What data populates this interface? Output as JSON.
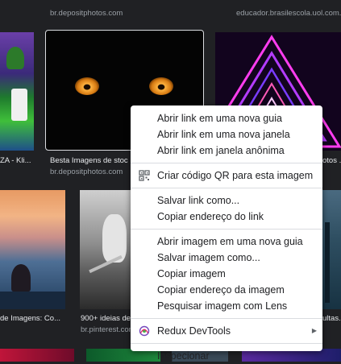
{
  "results": {
    "top_sources": [
      "br.depositphotos.com",
      "educador.brasilescola.uol.com.br"
    ],
    "row1": [
      {
        "caption": "ZA - Kli...",
        "source": ""
      },
      {
        "caption": "Besta Imagens de stoc",
        "source": "br.depositphotos.com"
      },
      {
        "caption": "otos ...",
        "source": ""
      }
    ],
    "row2": [
      {
        "caption": "de Imagens: Co...",
        "source": ""
      },
      {
        "caption": "900+ ideias de",
        "source": "br.pinterest.com"
      },
      {
        "caption": "ultas...",
        "source": ""
      }
    ]
  },
  "context_menu": {
    "groups": [
      [
        "Abrir link em uma nova guia",
        "Abrir link em uma nova janela",
        "Abrir link em janela anônima"
      ],
      [
        "Criar código QR para esta imagem"
      ],
      [
        "Salvar link como...",
        "Copiar endereço do link"
      ],
      [
        "Abrir imagem em uma nova guia",
        "Salvar imagem como...",
        "Copiar imagem",
        "Copiar endereço da imagem",
        "Pesquisar imagem com Lens"
      ],
      [
        "Redux DevTools"
      ],
      [
        "Inspecionar"
      ]
    ],
    "icons": {
      "qr": "qr-code-icon",
      "redux": "redux-icon",
      "submenu": "submenu-arrow-icon"
    }
  },
  "colors": {
    "page_bg": "#202124",
    "menu_bg": "#ffffff",
    "menu_text": "#202124",
    "separator": "#dadce0"
  }
}
